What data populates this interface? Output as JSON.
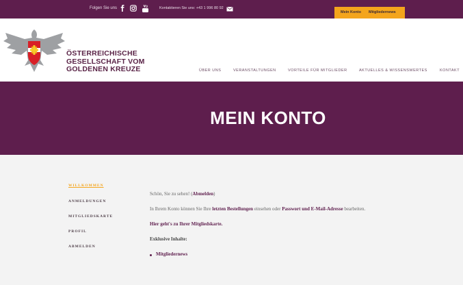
{
  "topbar": {
    "follow": "Folgen Sie uns",
    "contact": "Kontaktieren Sie uns: +43 1 996 80 92",
    "buttons": {
      "my_account": "Mein Konto",
      "newsletter": "Mitgliedernews"
    }
  },
  "logo": {
    "line1": "ÖSTERREICHISCHE",
    "line2": "GESELLSCHAFT VOM",
    "line3": "GOLDENEN KREUZE"
  },
  "nav": [
    {
      "label": "ÜBER UNS"
    },
    {
      "label": "VERANSTALTUNGEN"
    },
    {
      "label": "VORTEILE FÜR MITGLIEDER"
    },
    {
      "label": "AKTUELLES & WISSENSWERTES"
    },
    {
      "label": "KONTAKT"
    }
  ],
  "hero": {
    "title": "MEIN KONTO"
  },
  "sidebar": [
    {
      "label": "WILLKOMMEN",
      "active": true
    },
    {
      "label": "ANMELDUNGEN",
      "active": false
    },
    {
      "label": "MITGLIEDSKARTE",
      "active": false
    },
    {
      "label": "PROFIL",
      "active": false
    },
    {
      "label": "ABMELDEN",
      "active": false
    }
  ],
  "content": {
    "welcome_prefix": "Schön, Sie zu sehen! (",
    "logout": "Abmelden",
    "welcome_suffix": ")",
    "account_text_1": "In Ihrem Konto können Sie Ihre ",
    "orders_link": "letzten Bestellungen",
    "account_text_2": " einsehen oder ",
    "password_link": "Passwort und E-Mail-Adresse",
    "account_text_3": " bearbeiten.",
    "membership_card": "Hier geht's zu Ihrer Mitgliedskarte.",
    "exclusive_title": "Exklusive Inhalte:",
    "exclusive_items": [
      "Mitgliedernews"
    ]
  },
  "colors": {
    "brand_purple": "#5e1e4d",
    "accent_orange": "#f4a51c"
  },
  "icons": [
    "facebook-icon",
    "instagram-icon",
    "youtube-icon",
    "mail-icon",
    "eagle-logo-icon"
  ]
}
